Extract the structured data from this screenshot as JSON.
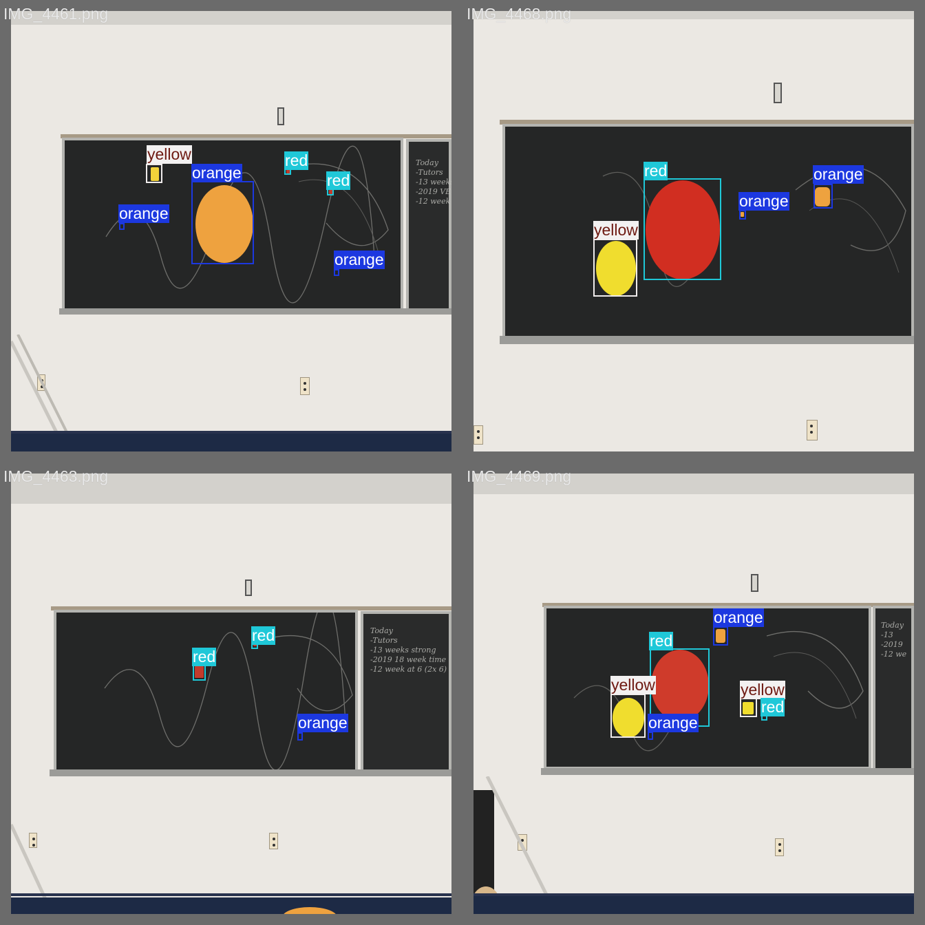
{
  "panels": [
    {
      "filename": "IMG_4461.png",
      "detections": [
        {
          "label": "yellow",
          "class": "yellow",
          "fill": "#f1d23a"
        },
        {
          "label": "orange",
          "class": "orange",
          "fill": "#eea23f"
        },
        {
          "label": "red",
          "class": "red",
          "fill": "#c23b2c"
        },
        {
          "label": "red",
          "class": "red",
          "fill": "#c23b2c"
        },
        {
          "label": "orange",
          "class": "orange",
          "fill": "#eea23f"
        },
        {
          "label": "orange",
          "class": "orange",
          "fill": "#eea23f"
        }
      ]
    },
    {
      "filename": "IMG_4468.png",
      "detections": [
        {
          "label": "red",
          "class": "red",
          "fill": "#d12e21"
        },
        {
          "label": "yellow",
          "class": "yellow",
          "fill": "#f0dd2e"
        },
        {
          "label": "orange",
          "class": "orange",
          "fill": "#eea23f"
        },
        {
          "label": "orange",
          "class": "orange",
          "fill": "#eea23f"
        }
      ]
    },
    {
      "filename": "IMG_4463.png",
      "detections": [
        {
          "label": "red",
          "class": "red",
          "fill": "#c23b2c"
        },
        {
          "label": "red",
          "class": "red",
          "fill": "#c23b2c"
        },
        {
          "label": "orange",
          "class": "orange",
          "fill": "#eea23f"
        }
      ]
    },
    {
      "filename": "IMG_4469.png",
      "detections": [
        {
          "label": "orange",
          "class": "orange",
          "fill": "#eea23f"
        },
        {
          "label": "red",
          "class": "red",
          "fill": "#cf3b2b"
        },
        {
          "label": "yellow",
          "class": "yellow",
          "fill": "#f0dd2e"
        },
        {
          "label": "orange",
          "class": "orange",
          "fill": "#eea23f"
        },
        {
          "label": "yellow",
          "class": "yellow",
          "fill": "#f0dd2e"
        },
        {
          "label": "red",
          "class": "red",
          "fill": "#c23b2c"
        }
      ]
    }
  ],
  "chalk_notes": {
    "board_1": "Today\n-Tutors\n-13 weeks\n-2019 VE\n-12 week",
    "board_3": "Today\n-Tutors\n-13 weeks strong\n-2019 18 week time\n-12 week at 6 (2x 6)",
    "board_4": "Today\n-13\n-2019\n-12 we"
  },
  "palette": {
    "box_red": "#1fc8d8",
    "box_orange": "#1c38e0",
    "box_yellow": "#f0ecec"
  }
}
